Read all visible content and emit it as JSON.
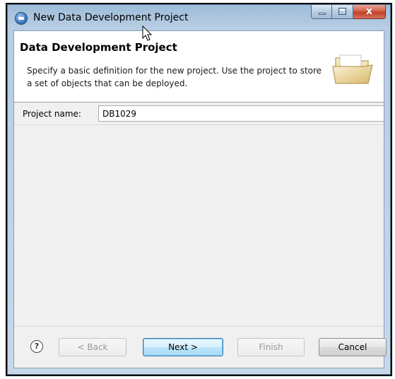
{
  "window": {
    "title": "New Data Development Project"
  },
  "header": {
    "title": "Data Development Project",
    "description": "Specify a basic definition for the new project.  Use the project to store a set of objects that can be deployed."
  },
  "form": {
    "project_name_label": "Project name:",
    "project_name_value": "DB1029"
  },
  "footer": {
    "help_label": "?",
    "back_label": "< Back",
    "next_label": "Next >",
    "finish_label": "Finish",
    "cancel_label": "Cancel"
  },
  "window_controls": {
    "close_label": "x"
  },
  "colors": {
    "titlebar": "#b6cde3",
    "default_button_border": "#3c7fb1",
    "close_button": "#c23e24"
  },
  "icons": [
    "app-icon",
    "minimize-icon",
    "maximize-icon",
    "close-icon",
    "folder-icon",
    "help-icon",
    "mouse-pointer-icon"
  ]
}
